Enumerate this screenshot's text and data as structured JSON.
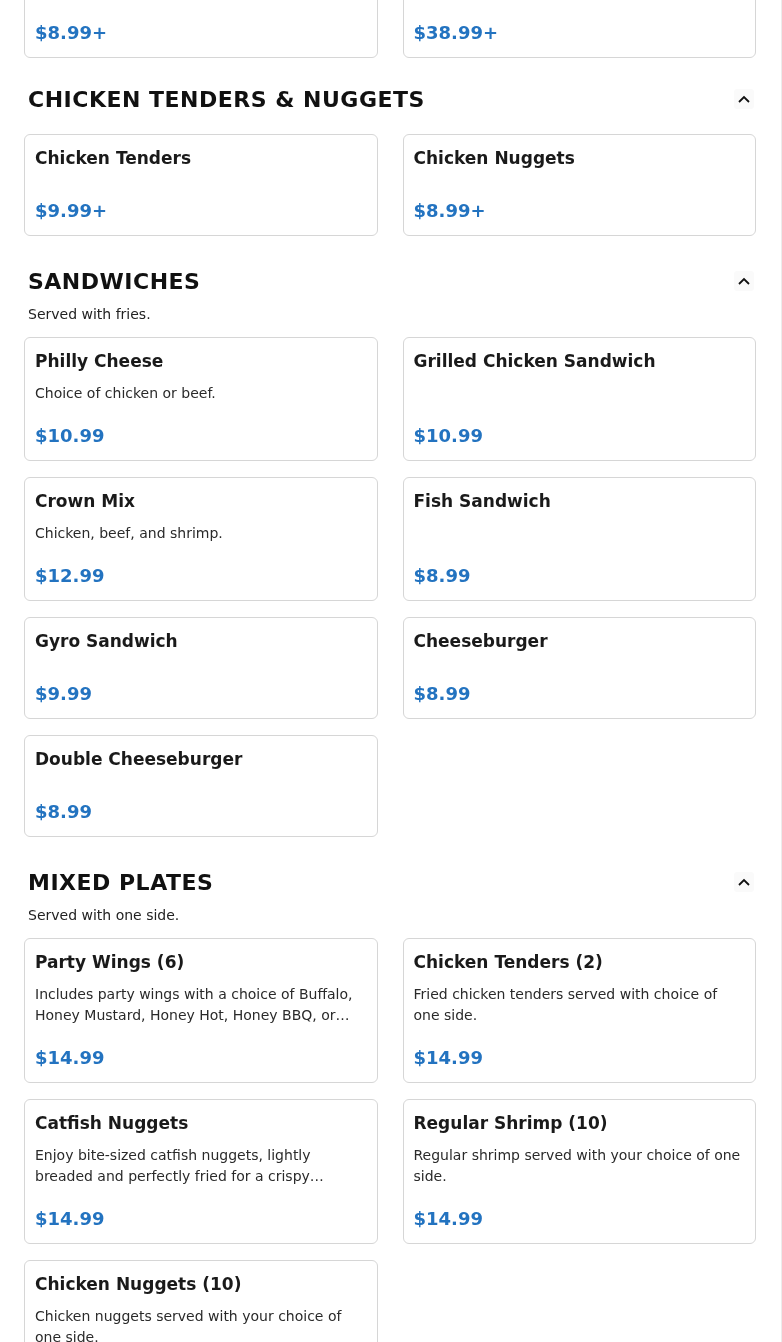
{
  "sections": [
    {
      "items": [
        {
          "price": "$8.99+"
        },
        {
          "price": "$38.99+"
        }
      ]
    },
    {
      "title": "CHICKEN TENDERS & NUGGETS",
      "expanded": true,
      "items": [
        {
          "name": "Chicken Tenders",
          "price": "$9.99+"
        },
        {
          "name": "Chicken Nuggets",
          "price": "$8.99+"
        }
      ]
    },
    {
      "title": "SANDWICHES",
      "subtitle": "Served with fries.",
      "expanded": true,
      "items": [
        {
          "name": "Philly Cheese",
          "description": "Choice of chicken or beef.",
          "price": "$10.99"
        },
        {
          "name": "Grilled Chicken Sandwich",
          "price": "$10.99"
        },
        {
          "name": "Crown Mix",
          "description": "Chicken, beef, and shrimp.",
          "price": "$12.99"
        },
        {
          "name": "Fish Sandwich",
          "price": "$8.99"
        },
        {
          "name": "Gyro Sandwich",
          "price": "$9.99"
        },
        {
          "name": "Cheeseburger",
          "price": "$8.99"
        },
        {
          "name": "Double Cheeseburger",
          "price": "$8.99"
        }
      ]
    },
    {
      "title": "MIXED PLATES",
      "subtitle": "Served with one side.",
      "expanded": true,
      "items": [
        {
          "name": "Party Wings (6)",
          "description": "Includes party wings with a choice of Buffalo, Honey Mustard, Honey Hot, Honey BBQ, or…",
          "price": "$14.99"
        },
        {
          "name": "Chicken Tenders (2)",
          "description": "Fried chicken tenders served with choice of one side.",
          "price": "$14.99"
        },
        {
          "name": "Catfish Nuggets",
          "description": "Enjoy bite-sized catfish nuggets, lightly breaded and perfectly fried for a crispy…",
          "price": "$14.99"
        },
        {
          "name": "Regular Shrimp (10)",
          "description": "Regular shrimp served with your choice of one side.",
          "price": "$14.99"
        },
        {
          "name": "Chicken Nuggets (10)",
          "description": "Chicken nuggets served with your choice of one side."
        }
      ]
    }
  ]
}
